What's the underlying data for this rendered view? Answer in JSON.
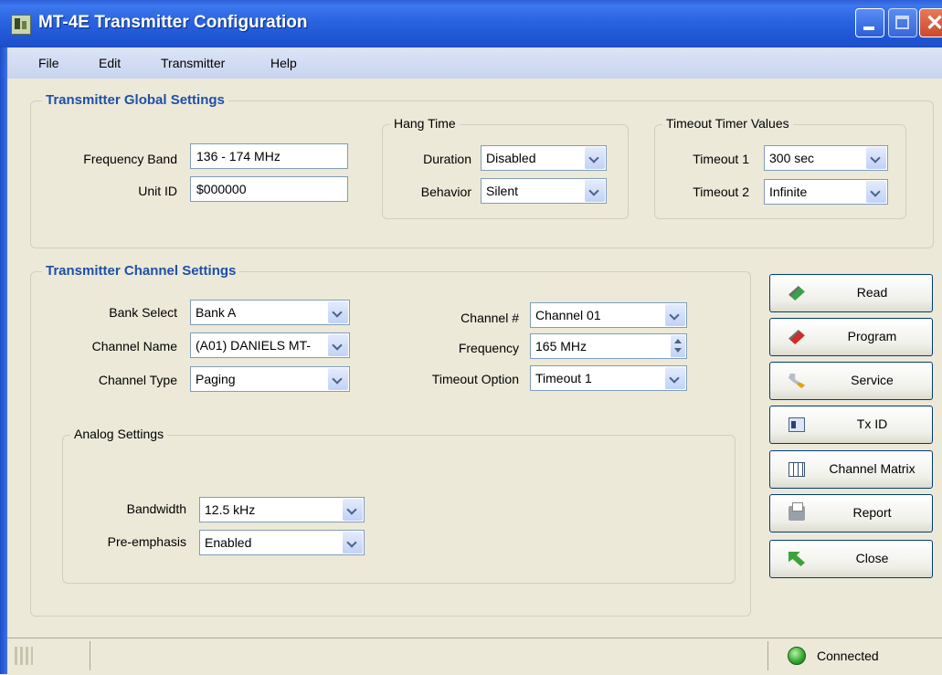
{
  "window": {
    "title": "MT-4E Transmitter Configuration"
  },
  "menu": {
    "file": "File",
    "edit": "Edit",
    "transmitter": "Transmitter",
    "help": "Help"
  },
  "global": {
    "title": "Transmitter Global Settings",
    "frequency_band_label": "Frequency Band",
    "frequency_band_value": "136 - 174 MHz",
    "unit_id_label": "Unit ID",
    "unit_id_value": "$000000",
    "hang_time": {
      "title": "Hang Time",
      "duration_label": "Duration",
      "duration_value": "Disabled",
      "behavior_label": "Behavior",
      "behavior_value": "Silent"
    },
    "timeout": {
      "title": "Timeout Timer Values",
      "t1_label": "Timeout 1",
      "t1_value": "300 sec",
      "t2_label": "Timeout 2",
      "t2_value": "Infinite"
    }
  },
  "channel": {
    "title": "Transmitter Channel Settings",
    "bank_select_label": "Bank Select",
    "bank_select_value": "Bank A",
    "channel_name_label": "Channel Name",
    "channel_name_value": "(A01)  DANIELS MT-",
    "channel_type_label": "Channel Type",
    "channel_type_value": "Paging",
    "channel_num_label": "Channel #",
    "channel_num_value": "Channel 01",
    "frequency_label": "Frequency",
    "frequency_value": "165 MHz",
    "timeout_option_label": "Timeout Option",
    "timeout_option_value": "Timeout 1",
    "analog": {
      "title": "Analog Settings",
      "bandwidth_label": "Bandwidth",
      "bandwidth_value": "12.5 kHz",
      "preemphasis_label": "Pre-emphasis",
      "preemphasis_value": "Enabled"
    }
  },
  "buttons": {
    "read": "Read",
    "program": "Program",
    "service": "Service",
    "txid": "Tx ID",
    "channel_matrix": "Channel Matrix",
    "report": "Report",
    "close": "Close"
  },
  "status": {
    "connection": "Connected",
    "connection_color": "#2ea32e"
  }
}
